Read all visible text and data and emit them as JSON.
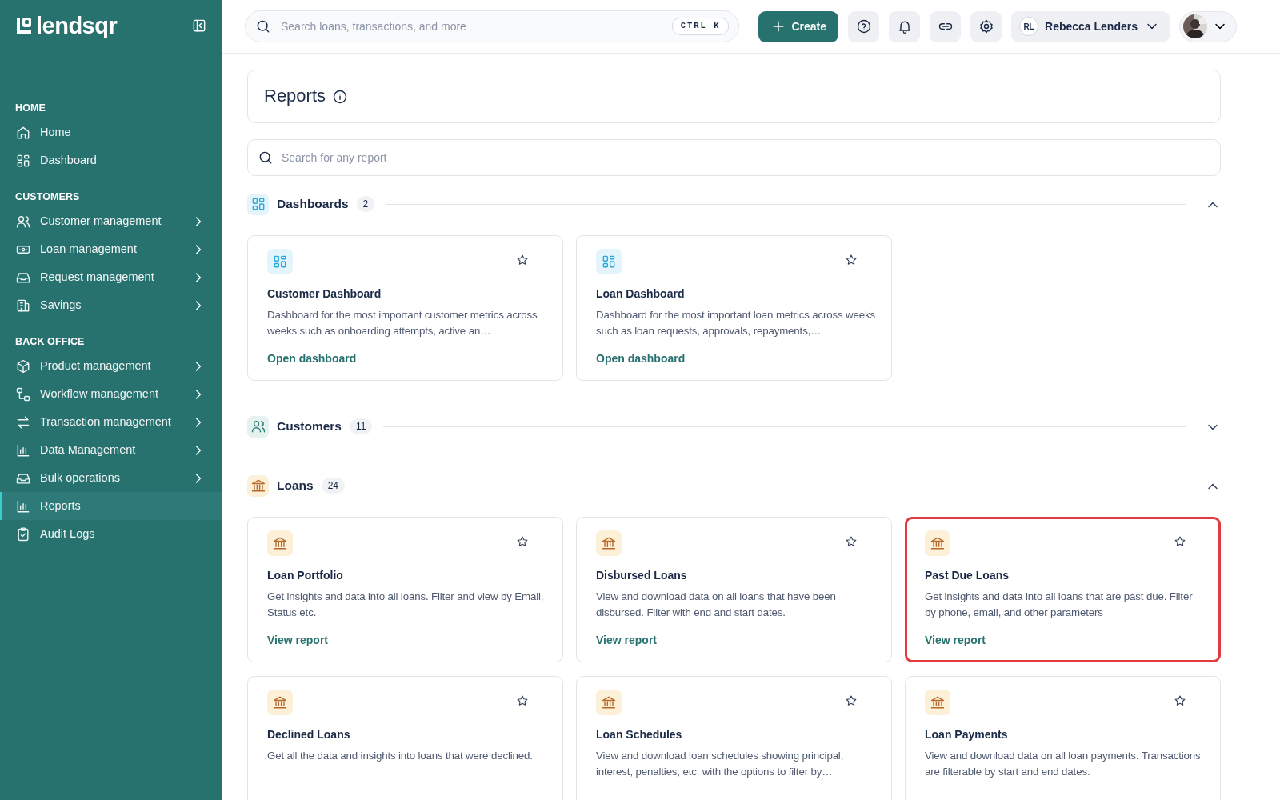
{
  "sidebar": {
    "logo": "lendsqr",
    "groups": [
      {
        "heading": "HOME",
        "items": [
          {
            "label": "Home",
            "expandable": false,
            "selected": false
          },
          {
            "label": "Dashboard",
            "expandable": false,
            "selected": false
          }
        ]
      },
      {
        "heading": "CUSTOMERS",
        "items": [
          {
            "label": "Customer management",
            "expandable": true,
            "selected": false
          },
          {
            "label": "Loan management",
            "expandable": true,
            "selected": false
          },
          {
            "label": "Request management",
            "expandable": true,
            "selected": false
          },
          {
            "label": "Savings",
            "expandable": true,
            "selected": false
          }
        ]
      },
      {
        "heading": "BACK OFFICE",
        "items": [
          {
            "label": "Product management",
            "expandable": true,
            "selected": false
          },
          {
            "label": "Workflow management",
            "expandable": true,
            "selected": false
          },
          {
            "label": "Transaction management",
            "expandable": true,
            "selected": false
          },
          {
            "label": "Data Management",
            "expandable": true,
            "selected": false
          },
          {
            "label": "Bulk operations",
            "expandable": true,
            "selected": false
          },
          {
            "label": "Reports",
            "expandable": false,
            "selected": true
          },
          {
            "label": "Audit Logs",
            "expandable": false,
            "selected": false
          }
        ]
      }
    ]
  },
  "topbar": {
    "search": {
      "placeholder": "Search loans, transactions, and more",
      "shortcut": "CTRL K"
    },
    "create_button": "Create",
    "user": {
      "initials": "RL",
      "name": "Rebecca Lenders"
    }
  },
  "page": {
    "title": "Reports",
    "search": {
      "placeholder": "Search for any report"
    },
    "sections": [
      {
        "title": "Dashboards",
        "count": "2",
        "expanded": true,
        "cards": [
          {
            "title": "Customer Dashboard",
            "description": "Dashboard for the most important customer metrics across weeks such as onboarding attempts, active an…",
            "link": "Open dashboard",
            "highlighted": false
          },
          {
            "title": "Loan Dashboard",
            "description": "Dashboard for the most important loan metrics across weeks such as loan requests, approvals, repayments,…",
            "link": "Open dashboard",
            "highlighted": false
          }
        ]
      },
      {
        "title": "Customers",
        "count": "11",
        "expanded": false
      },
      {
        "title": "Loans",
        "count": "24",
        "expanded": true,
        "cards": [
          {
            "title": "Loan Portfolio",
            "description": "Get insights and data into all loans. Filter and view by Email, Status etc.",
            "link": "View report",
            "highlighted": false
          },
          {
            "title": "Disbursed Loans",
            "description": "View and download data on all loans that have been disbursed. Filter with end and start dates.",
            "link": "View report",
            "highlighted": false
          },
          {
            "title": "Past Due Loans",
            "description": "Get insights and data into all loans that are past due. Filter by phone, email, and other parameters",
            "link": "View report",
            "highlighted": true
          },
          {
            "title": "Declined Loans",
            "description": "Get all the data and insights into loans that were declined.",
            "highlighted": false
          },
          {
            "title": "Loan Schedules",
            "description": "View and download loan schedules showing principal, interest, penalties, etc. with the options to filter by…",
            "highlighted": false
          },
          {
            "title": "Loan Payments",
            "description": "View and download data on all loan payments. Transactions are filterable by start and end dates.",
            "highlighted": false
          }
        ]
      }
    ]
  }
}
